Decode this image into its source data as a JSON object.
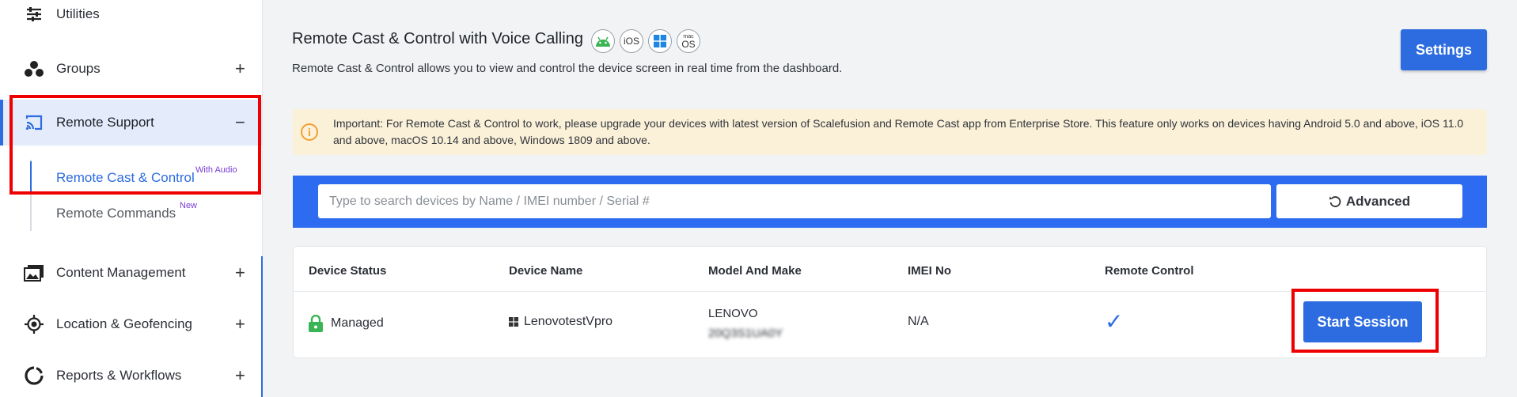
{
  "sidebar": {
    "items": [
      {
        "label": "Utilities",
        "icon": "sliders-icon"
      },
      {
        "label": "Groups",
        "icon": "groups-icon",
        "expand": "+"
      },
      {
        "label": "Remote Support",
        "icon": "cast-icon",
        "expand": "−"
      },
      {
        "label": "Content Management",
        "icon": "photos-icon",
        "expand": "+"
      },
      {
        "label": "Location & Geofencing",
        "icon": "location-target-icon",
        "expand": "+"
      },
      {
        "label": "Reports & Workflows",
        "icon": "reports-ring-icon",
        "expand": "+"
      }
    ],
    "subitems": [
      {
        "label": "Remote Cast & Control",
        "badge": "With Audio"
      },
      {
        "label": "Remote Commands",
        "badge": "New"
      }
    ]
  },
  "main": {
    "title": "Remote Cast & Control with Voice Calling",
    "os_badges": [
      "android-icon",
      "iOS",
      "windows-icon",
      "macOS"
    ],
    "ios_label": "iOS",
    "macos_label_top": "mac",
    "macos_label_bottom": "OS",
    "description": "Remote Cast & Control allows you to view and control the device screen in real time from the dashboard.",
    "settings_label": "Settings",
    "alert_text": "Important: For Remote Cast & Control to work, please upgrade your devices with latest version of Scalefusion and Remote Cast app from Enterprise Store. This feature only works on devices having Android 5.0 and above, iOS 11.0 and above, macOS 10.14 and above, Windows 1809 and above.",
    "search_placeholder": "Type to search devices by Name / IMEI number / Serial #",
    "advanced_label": "Advanced"
  },
  "table": {
    "columns": [
      "Device Status",
      "Device Name",
      "Model And Make",
      "IMEI No",
      "Remote Control"
    ],
    "rows": [
      {
        "status": "Managed",
        "name": "LenovotestVpro",
        "model_line1": "LENOVO",
        "model_line2": "20Q3S1UA0Y",
        "imei": "N/A",
        "remote_control": "✓",
        "action": "Start Session"
      }
    ]
  },
  "colors": {
    "accent": "#2d6ce0",
    "highlight_box": "#ee0000",
    "alert_bg": "#fbf1d9",
    "badge_purple": "#7a3dd6"
  }
}
